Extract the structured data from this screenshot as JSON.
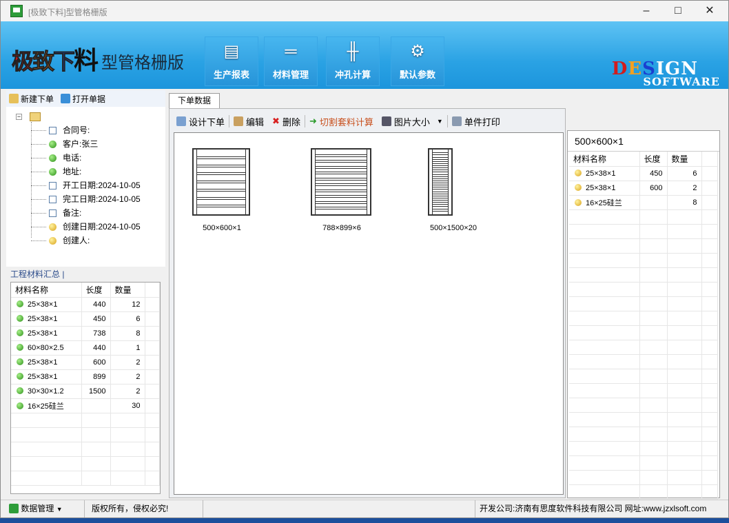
{
  "window": {
    "title": "[极致下料]型管格栅版"
  },
  "banner": {
    "logo": "极致下料",
    "subtitle": "型管格栅版",
    "tools": [
      {
        "label": "生产报表",
        "icon": "chart-icon"
      },
      {
        "label": "材料管理",
        "icon": "material-icon"
      },
      {
        "label": "冲孔计算",
        "icon": "punch-icon"
      },
      {
        "label": "默认参数",
        "icon": "gear-icon"
      }
    ],
    "design_text": "DESIGN",
    "software_text": "SOFTWARE"
  },
  "left_toolbar": {
    "new_order": "新建下单",
    "open_order": "打开单据"
  },
  "tree": [
    {
      "label": "合同号:",
      "icon": "doc"
    },
    {
      "label": "客户:张三",
      "icon": "green"
    },
    {
      "label": "电话:",
      "icon": "green"
    },
    {
      "label": "地址:",
      "icon": "green"
    },
    {
      "label": "开工日期:2024-10-05",
      "icon": "doc"
    },
    {
      "label": "完工日期:2024-10-05",
      "icon": "doc"
    },
    {
      "label": "备注:",
      "icon": "doc"
    },
    {
      "label": "创建日期:2024-10-05",
      "icon": "yellow"
    },
    {
      "label": "创建人:",
      "icon": "yellow"
    }
  ],
  "summary": {
    "tab": "工程材料汇总",
    "headers": [
      "材料名称",
      "长度",
      "数量"
    ],
    "rows": [
      [
        "25×38×1",
        "440",
        "12"
      ],
      [
        "25×38×1",
        "450",
        "6"
      ],
      [
        "25×38×1",
        "738",
        "8"
      ],
      [
        "60×80×2.5",
        "440",
        "1"
      ],
      [
        "25×38×1",
        "600",
        "2"
      ],
      [
        "25×38×1",
        "899",
        "2"
      ],
      [
        "30×30×1.2",
        "1500",
        "2"
      ],
      [
        "16×25硅兰",
        "",
        "30"
      ]
    ]
  },
  "center": {
    "tab": "下单数据",
    "toolbar": {
      "design": "设计下单",
      "edit": "编辑",
      "delete": "删除",
      "cut": "切割套料计算",
      "img_size": "图片大小",
      "print": "单件打印"
    },
    "figures": [
      {
        "caption": "500×600×1",
        "bars": 7
      },
      {
        "caption": "788×899×6",
        "bars": 10
      },
      {
        "caption": "500×1500×20",
        "bars": 14
      }
    ]
  },
  "right": {
    "title": "500×600×1",
    "headers": [
      "材料名称",
      "长度",
      "数量"
    ],
    "rows": [
      [
        "25×38×1",
        "450",
        "6"
      ],
      [
        "25×38×1",
        "600",
        "2"
      ],
      [
        "16×25硅兰",
        "",
        "8"
      ]
    ]
  },
  "status": {
    "data_mgmt": "数据管理",
    "copyright": "版权所有，侵权必究!",
    "company": "开发公司:济南有思度软件科技有限公司 网址:www.jzxlsoft.com"
  },
  "colors": {
    "banner_top": "#5fc3f4",
    "banner_bottom": "#1c95dc",
    "accent_cut": "#c8501e"
  }
}
